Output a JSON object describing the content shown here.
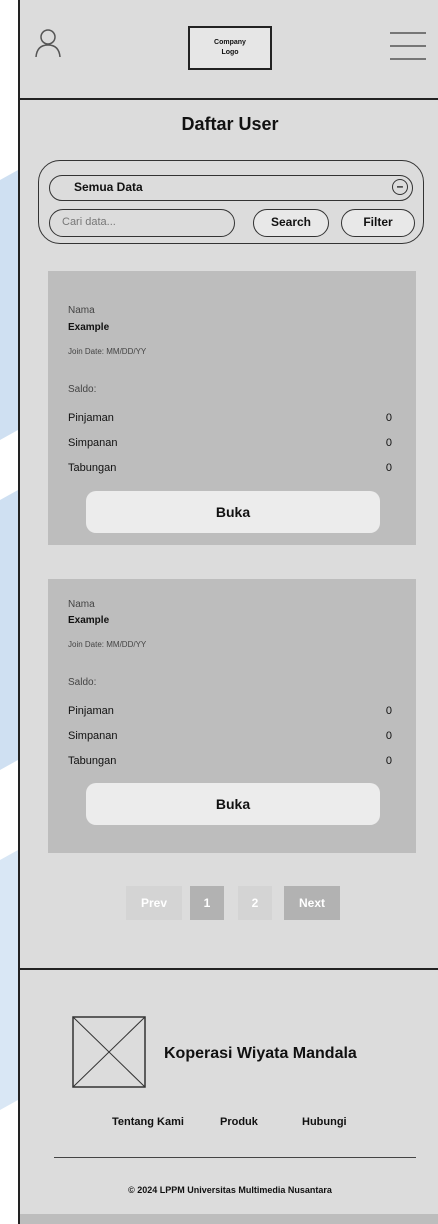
{
  "header": {
    "logo_line1": "Company",
    "logo_line2": "Logo",
    "user_icon": "user-icon",
    "menu_icon": "hamburger-menu-icon"
  },
  "page_title": "Daftar User",
  "filter_panel": {
    "select_value": "Semua Data",
    "search_placeholder": "Cari data...",
    "search_label": "Search",
    "filter_label": "Filter"
  },
  "users": [
    {
      "nama_label": "Nama",
      "nama": "Example",
      "join_date": "Join Date: MM/DD/YY",
      "saldo_label": "Saldo:",
      "pinjaman_label": "Pinjaman",
      "pinjaman": "0",
      "simpanan_label": "Simpanan",
      "simpanan": "0",
      "tabungan_label": "Tabungan",
      "tabungan": "0",
      "button_label": "Buka"
    },
    {
      "nama_label": "Nama",
      "nama": "Example",
      "join_date": "Join Date: MM/DD/YY",
      "saldo_label": "Saldo:",
      "pinjaman_label": "Pinjaman",
      "pinjaman": "0",
      "simpanan_label": "Simpanan",
      "simpanan": "0",
      "tabungan_label": "Tabungan",
      "tabungan": "0",
      "button_label": "Buka"
    }
  ],
  "pagination": {
    "prev": "Prev",
    "page1": "1",
    "page2": "2",
    "next": "Next"
  },
  "footer": {
    "brand": "Koperasi Wiyata Mandala",
    "links": [
      "Tentang Kami",
      "Produk",
      "Hubungi"
    ],
    "copyright": "© 2024 LPPM Universitas Multimedia Nusantara"
  },
  "colors": {
    "frame_bg": "#dcdcdc",
    "card_bg": "#bdbdbd",
    "button_bg": "#ececec"
  }
}
